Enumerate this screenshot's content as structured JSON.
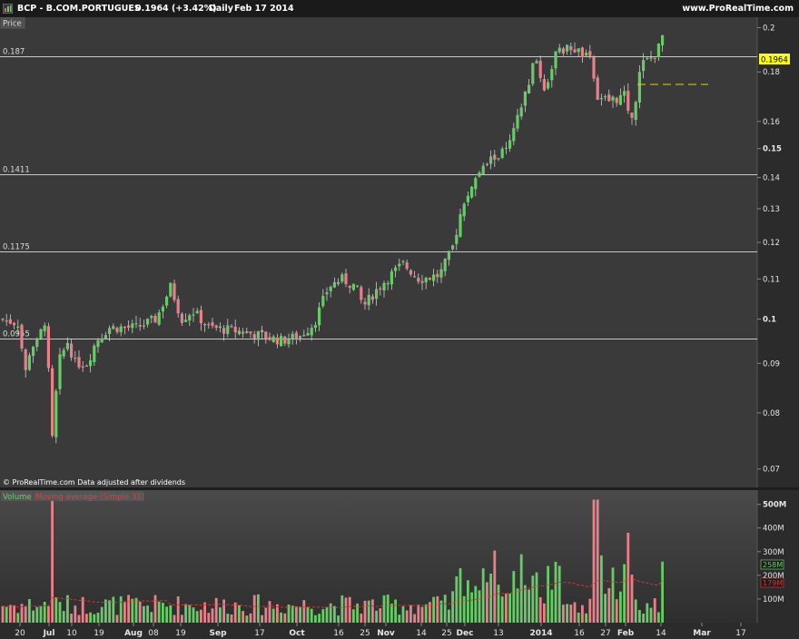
{
  "header": {
    "symbol": "BCP - B.COM.PORTUGUES",
    "last": "0.1964 (+3.42%)",
    "period": "Daily",
    "date": "Feb 17 2014",
    "brand": "www.ProRealTime.com"
  },
  "price_panel": {
    "title": "Price",
    "footer": "© ProRealTime.com Data adjusted after dividends",
    "last_value_label": "0.1964"
  },
  "volume_panel": {
    "volume_label": "Volume",
    "ma_label": "Moving average (Simple 31)",
    "volume_value_label": "258M",
    "ma_value_label": "179M"
  },
  "colors": {
    "up": "#66cc66",
    "down": "#e8808a",
    "hline": "#c8c8c8",
    "ma": "#dd3333",
    "last_label_bg": "#ffff00"
  },
  "chart_data": {
    "type": "candlestick",
    "series": [
      {
        "name": "Price",
        "ohlc_sample": [
          {
            "date": "2013-07-04",
            "close": 0.075
          },
          {
            "date": "2013-08-20",
            "close": 0.11
          },
          {
            "date": "2013-10-01",
            "close": 0.095
          },
          {
            "date": "2013-11-20",
            "close": 0.112
          },
          {
            "date": "2013-12-31",
            "close": 0.185
          },
          {
            "date": "2014-01-31",
            "close": 0.16
          },
          {
            "date": "2014-02-17",
            "close": 0.1964
          }
        ]
      },
      {
        "name": "Volume"
      },
      {
        "name": "Moving average (Simple 31)"
      }
    ],
    "horizontal_levels": [
      "0.187",
      "0.1411",
      "0.1175",
      "0.0955"
    ],
    "y_ticks": [
      "0.2",
      "0.18",
      "0.16",
      "0.15",
      "0.14",
      "0.13",
      "0.12",
      "0.11",
      "0.1",
      "0.09",
      "0.08",
      "0.07"
    ],
    "volume_ticks": [
      "500M",
      "400M",
      "300M",
      "200M",
      "100M"
    ],
    "x_ticks": [
      "20",
      "Jul",
      "10",
      "19",
      "Aug",
      "08",
      "19",
      "Sep",
      "17",
      "Oct",
      "16",
      "25",
      "Nov",
      "14",
      "25",
      "Dec",
      "13",
      "2014",
      "16",
      "27",
      "Feb",
      "14",
      "Mar",
      "17"
    ],
    "y_scale": "log",
    "ylim": [
      0.067,
      0.205
    ],
    "volume_ylim": [
      0,
      560000000
    ]
  }
}
